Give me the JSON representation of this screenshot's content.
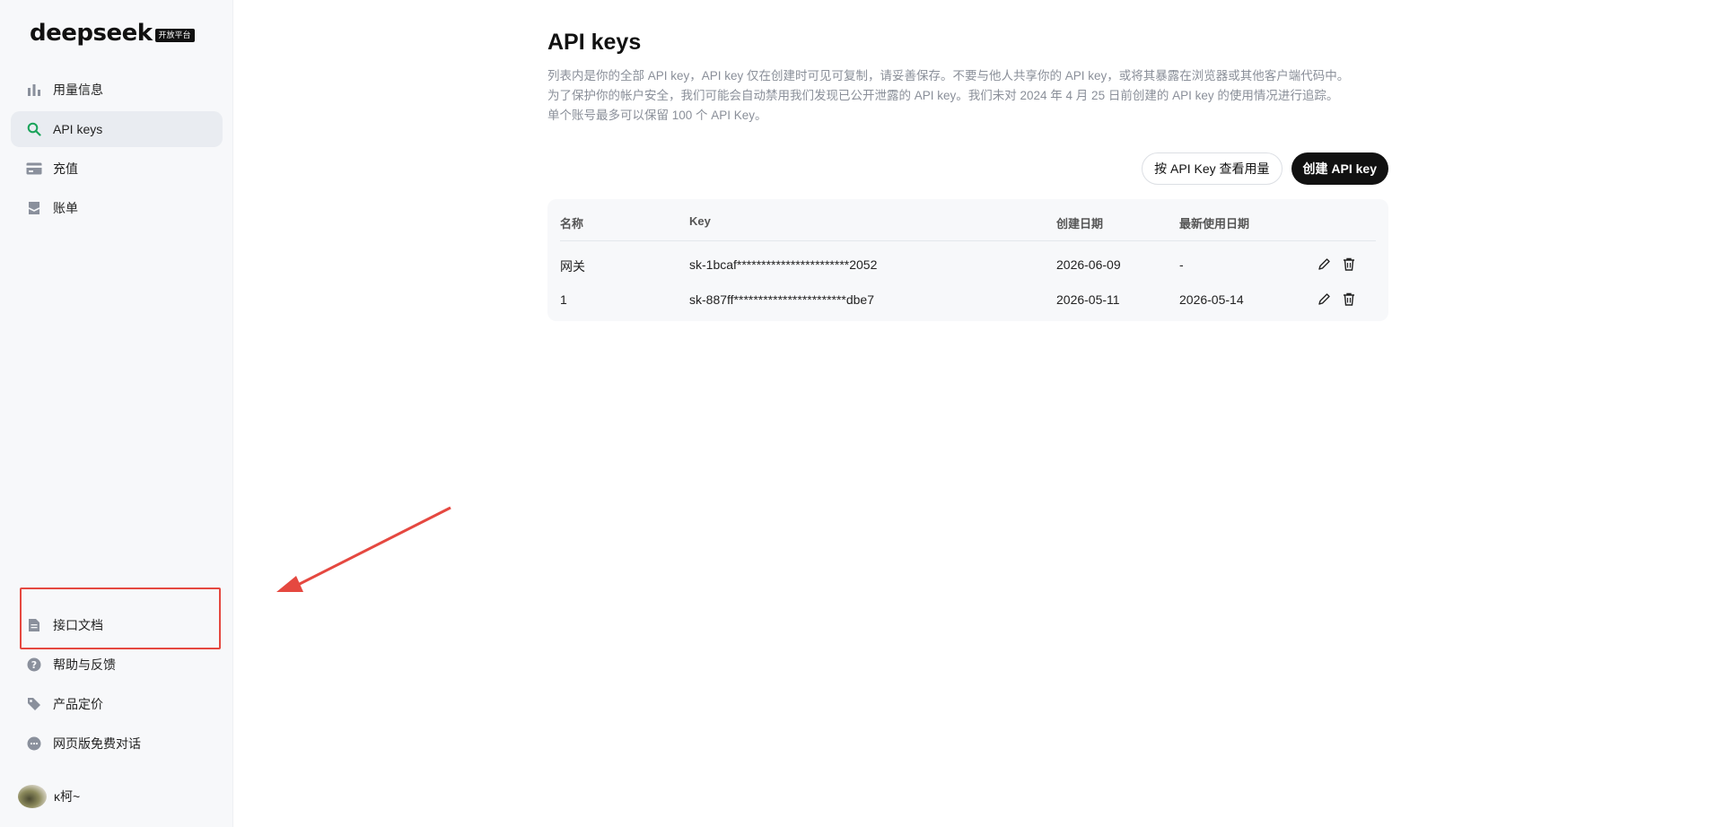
{
  "brand": {
    "logo_text": "deepseek",
    "badge": "开放平台"
  },
  "sidebar": {
    "top_items": [
      {
        "label": "用量信息",
        "icon": "bar-chart-icon"
      },
      {
        "label": "API keys",
        "icon": "search-icon",
        "active": true
      },
      {
        "label": "充值",
        "icon": "card-icon"
      },
      {
        "label": "账单",
        "icon": "inbox-icon"
      }
    ],
    "bottom_items": [
      {
        "label": "接口文档",
        "icon": "document-icon"
      },
      {
        "label": "帮助与反馈",
        "icon": "help-icon"
      },
      {
        "label": "产品定价",
        "icon": "tag-icon"
      },
      {
        "label": "网页版免费对话",
        "icon": "chat-icon"
      }
    ],
    "user": {
      "name": "κ柯~"
    }
  },
  "main": {
    "title": "API keys",
    "description": [
      "列表内是你的全部 API key，API key 仅在创建时可见可复制，请妥善保存。不要与他人共享你的 API key，或将其暴露在浏览器或其他客户端代码中。",
      "为了保护你的帐户安全，我们可能会自动禁用我们发现已公开泄露的 API key。我们未对 2024 年 4 月 25 日前创建的 API key 的使用情况进行追踪。",
      "单个账号最多可以保留 100 个 API Key。"
    ],
    "buttons": {
      "usage_by_key": "按 API Key 查看用量",
      "create_key": "创建 API key"
    },
    "table": {
      "headers": {
        "name": "名称",
        "key": "Key",
        "created": "创建日期",
        "last_used": "最新使用日期"
      },
      "rows": [
        {
          "name": "网关",
          "key": "sk-1bcaf***********************2052",
          "created": "2026-06-09",
          "last_used": "-"
        },
        {
          "name": "1",
          "key": "sk-887ff***********************dbe7",
          "created": "2026-05-11",
          "last_used": "2026-05-14"
        }
      ]
    }
  },
  "colors": {
    "accent_active_icon": "#1aa35a",
    "annotation_red": "#e54840",
    "dark_button": "#111111"
  }
}
